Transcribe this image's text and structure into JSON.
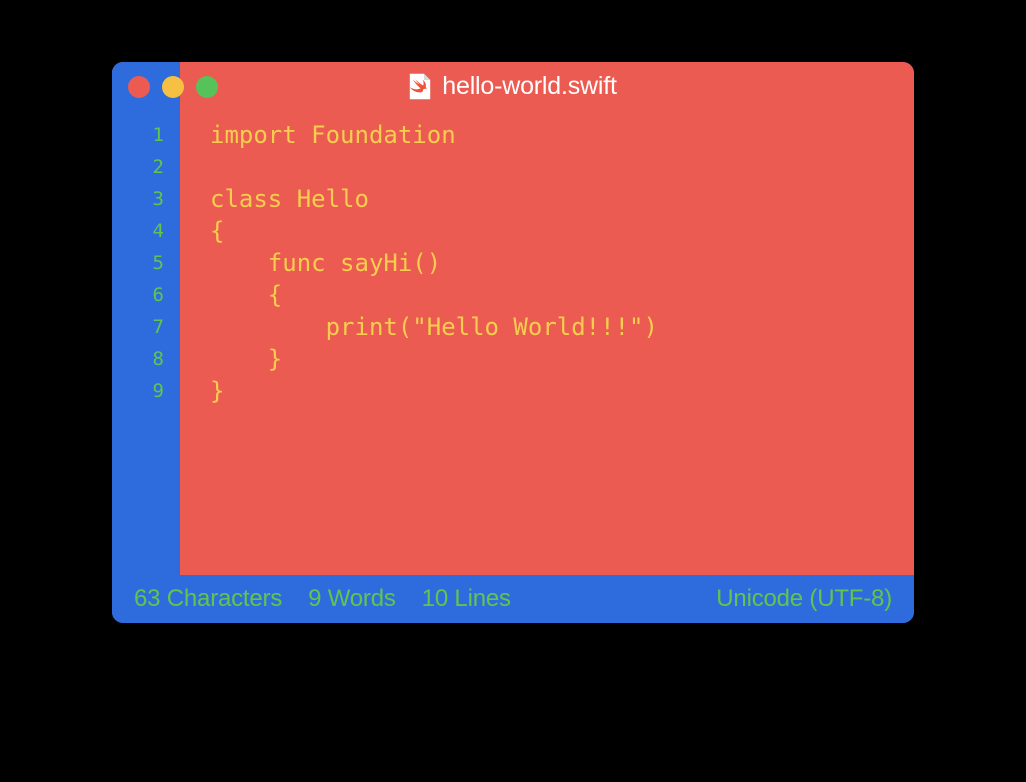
{
  "window": {
    "title": "hello-world.swift",
    "file_icon": "swift-file-icon",
    "traffic_lights": [
      {
        "name": "close",
        "label": "Close",
        "color": "#eb5b51"
      },
      {
        "name": "minimize",
        "label": "Minimize",
        "color": "#f6c143"
      },
      {
        "name": "zoom",
        "label": "Zoom",
        "color": "#57c25a"
      }
    ]
  },
  "theme": {
    "window_background": "#2e6cde",
    "editor_background": "#eb5b51",
    "gutter_background": "#2e6cde",
    "code_text": "#f5ce4e",
    "line_number_text": "#5ec64e",
    "status_text": "#5ec64e",
    "title_text": "#ffffff",
    "desktop_background": "#000000"
  },
  "editor": {
    "line_numbers": [
      "1",
      "2",
      "3",
      "4",
      "5",
      "6",
      "7",
      "8",
      "9"
    ],
    "lines": [
      "import Foundation",
      "",
      "class Hello",
      "{",
      "    func sayHi()",
      "    {",
      "        print(\"Hello World!!!\")",
      "    }",
      "}"
    ]
  },
  "statusbar": {
    "characters": "63 Characters",
    "words": "9 Words",
    "lines": "10 Lines",
    "encoding": "Unicode (UTF-8)"
  }
}
